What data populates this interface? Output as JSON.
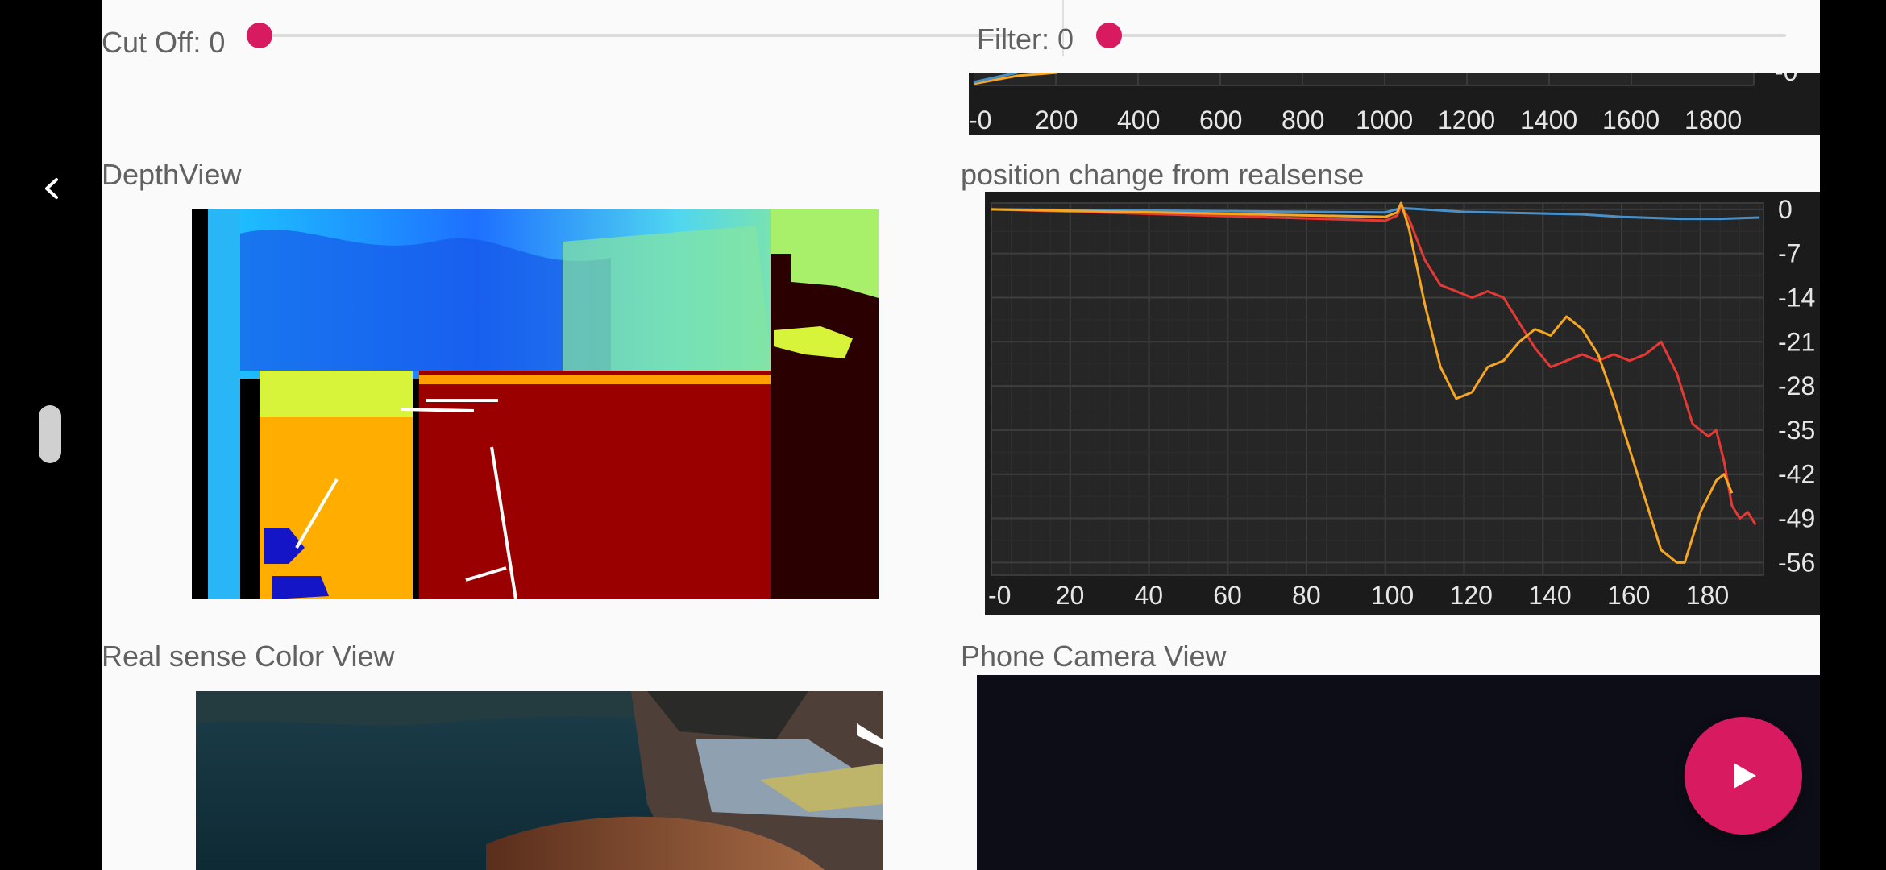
{
  "controls": {
    "cutoff_label": "Cut Off: 0",
    "cutoff_value": 0,
    "filter_label": "Filter: 0",
    "filter_value": 0
  },
  "sections": {
    "depth_view_title": "DepthView",
    "position_chart_title": "position change from realsense",
    "realsense_color_title": "Real sense Color View",
    "phone_camera_title": "Phone Camera View"
  },
  "top_chart": {
    "x_ticks": [
      "-0",
      "200",
      "400",
      "600",
      "800",
      "1000",
      "1200",
      "1400",
      "1600",
      "1800"
    ],
    "y_tick": "-0"
  },
  "chart_data": {
    "type": "line",
    "title": "position change from realsense",
    "xlabel": "",
    "ylabel": "",
    "xlim": [
      0,
      196
    ],
    "ylim": [
      -58,
      1
    ],
    "x_ticks": [
      "-0",
      "20",
      "40",
      "60",
      "80",
      "100",
      "120",
      "140",
      "160",
      "180"
    ],
    "y_ticks": [
      "0",
      "-7",
      "-14",
      "-21",
      "-28",
      "-35",
      "-42",
      "-49",
      "-56"
    ],
    "grid": true,
    "series": [
      {
        "color": "#4a90c8",
        "points": [
          [
            0,
            0
          ],
          [
            100,
            -0.5
          ],
          [
            104,
            0.2
          ],
          [
            120,
            -0.4
          ],
          [
            150,
            -0.8
          ],
          [
            160,
            -1.2
          ],
          [
            175,
            -1.5
          ],
          [
            185,
            -1.5
          ],
          [
            195,
            -1.3
          ]
        ]
      },
      {
        "color": "#e53935",
        "points": [
          [
            0,
            0
          ],
          [
            100,
            -1.8
          ],
          [
            103,
            -1
          ],
          [
            104,
            0.5
          ],
          [
            106,
            -1.5
          ],
          [
            110,
            -8
          ],
          [
            114,
            -12
          ],
          [
            118,
            -13
          ],
          [
            122,
            -14
          ],
          [
            126,
            -13
          ],
          [
            130,
            -14
          ],
          [
            134,
            -18
          ],
          [
            138,
            -22
          ],
          [
            142,
            -25
          ],
          [
            146,
            -24
          ],
          [
            150,
            -23
          ],
          [
            154,
            -24
          ],
          [
            158,
            -23
          ],
          [
            162,
            -24
          ],
          [
            166,
            -23
          ],
          [
            170,
            -21
          ],
          [
            174,
            -26
          ],
          [
            178,
            -34
          ],
          [
            182,
            -36
          ],
          [
            184,
            -35
          ],
          [
            186,
            -40
          ],
          [
            188,
            -47
          ],
          [
            190,
            -49
          ],
          [
            192,
            -48
          ],
          [
            194,
            -50
          ]
        ]
      },
      {
        "color": "#f5a623",
        "points": [
          [
            0,
            0
          ],
          [
            100,
            -1.2
          ],
          [
            103,
            -0.5
          ],
          [
            104,
            1
          ],
          [
            106,
            -3
          ],
          [
            110,
            -15
          ],
          [
            114,
            -25
          ],
          [
            118,
            -30
          ],
          [
            122,
            -29
          ],
          [
            126,
            -25
          ],
          [
            130,
            -24
          ],
          [
            134,
            -21
          ],
          [
            138,
            -19
          ],
          [
            142,
            -20
          ],
          [
            146,
            -17
          ],
          [
            150,
            -19
          ],
          [
            154,
            -23
          ],
          [
            158,
            -30
          ],
          [
            162,
            -38
          ],
          [
            166,
            -46
          ],
          [
            170,
            -54
          ],
          [
            174,
            -56
          ],
          [
            176,
            -56
          ],
          [
            180,
            -48
          ],
          [
            184,
            -43
          ],
          [
            186,
            -42
          ],
          [
            188,
            -45
          ]
        ]
      }
    ]
  },
  "fab": {
    "icon": "play-icon",
    "color": "#d81b60"
  }
}
